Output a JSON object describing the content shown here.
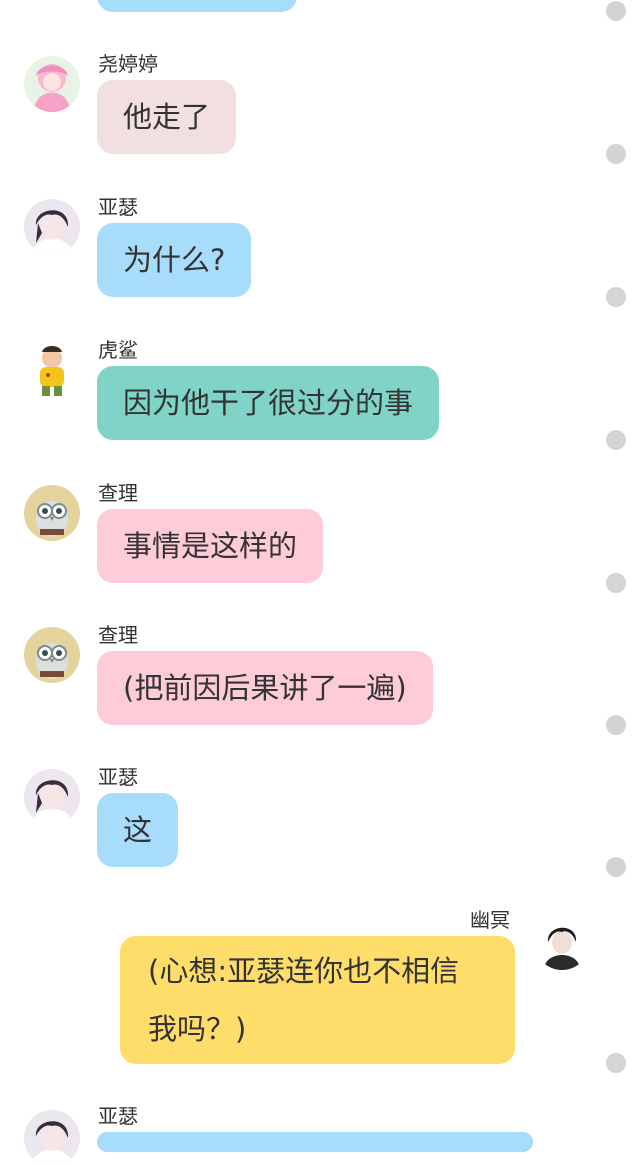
{
  "messages": [
    {
      "id": "m0",
      "sender": "",
      "text": "",
      "color": "#a7dcfb",
      "side": "left"
    },
    {
      "id": "m1",
      "sender": "尧婷婷",
      "text": "他走了",
      "color": "#f2dfe0",
      "side": "left",
      "avatar": "pink-hair-girl-avatar"
    },
    {
      "id": "m2",
      "sender": "亚瑟",
      "text": "为什么?",
      "color": "#a7dcfb",
      "side": "left",
      "avatar": "dark-hair-boy-avatar"
    },
    {
      "id": "m3",
      "sender": "虎鲨",
      "text": "因为他干了很过分的事",
      "color": "#7fd3c7",
      "side": "left",
      "avatar": "yellow-shirt-kid-avatar"
    },
    {
      "id": "m4",
      "sender": "查理",
      "text": "事情是这样的",
      "color": "#fecbd9",
      "side": "left",
      "avatar": "owl-avatar"
    },
    {
      "id": "m5",
      "sender": "查理",
      "text": "(把前因后果讲了一遍)",
      "color": "#fecbd9",
      "side": "left",
      "avatar": "owl-avatar"
    },
    {
      "id": "m6",
      "sender": "亚瑟",
      "text": "这",
      "color": "#a7dcfb",
      "side": "left",
      "avatar": "dark-hair-boy-avatar"
    },
    {
      "id": "m7",
      "sender": "幽冥",
      "text": "(心想:亚瑟连你也不相信我吗？)",
      "color": "#ffdd6b",
      "side": "right",
      "avatar": "dark-hair-man-avatar"
    },
    {
      "id": "m8",
      "sender": "亚瑟",
      "text": "",
      "color": "#a7dcfb",
      "side": "left",
      "avatar": "dark-hair-boy-avatar"
    }
  ]
}
